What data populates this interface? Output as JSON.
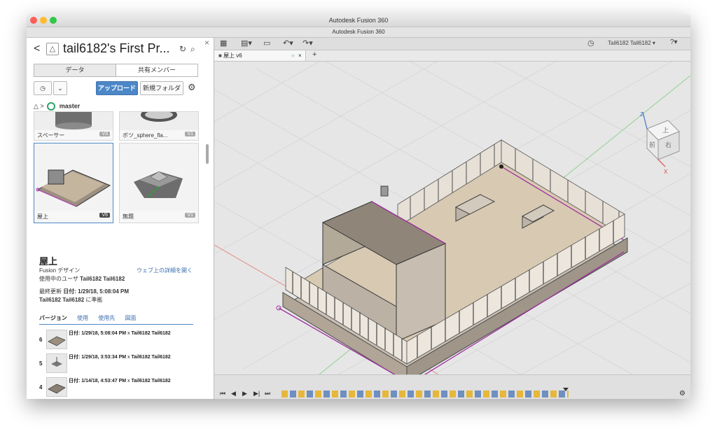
{
  "window": {
    "title": "Autodesk Fusion 360",
    "subtitle": "Autodesk Fusion 360",
    "traffic_colors": [
      "#fc5f57",
      "#fdbc2e",
      "#33c748"
    ]
  },
  "panel": {
    "back_label": "<",
    "project_title": "tail6182's First Pr...",
    "refresh_icon": "↻",
    "search_icon": "⌕",
    "close_label": "×",
    "tabs": [
      "データ",
      "共有メンバー"
    ],
    "upload_label": "アップロード",
    "new_folder_label": "新規フォルダ",
    "gear_icon": "⚙",
    "dropdown_icon": "⌄",
    "clock_icon": "◷",
    "branch_prefix": "△ >",
    "branch": "master",
    "files": [
      {
        "name": "スペーサー",
        "version": "V3"
      },
      {
        "name": "ボツ_sphere_fla...",
        "version": "V1"
      },
      {
        "name": "屋上",
        "version": "V6"
      },
      {
        "name": "無題",
        "version": "V1"
      }
    ]
  },
  "details": {
    "title": "屋上",
    "type": "Fusion デザイン",
    "web_link": "ウェブ上の詳細を開く",
    "user_label": "使用中のユーザ",
    "user_name": "Tail6182 Tail6182",
    "updated_label": "最終更新",
    "updated_value": "日付: 1/29/18, 5:08:04 PM",
    "updated_by": "Tail6182 Tail6182",
    "updated_suffix": "に準拠",
    "tabs": [
      "バージョン",
      "使用",
      "使用先",
      "図面"
    ],
    "versions": [
      {
        "num": "6",
        "date": "日付: 1/29/18, 5:08:04 PM",
        "sep": "x",
        "user": "Tail6182 Tail6182"
      },
      {
        "num": "5",
        "date": "日付: 1/29/18, 3:53:34 PM",
        "sep": "x",
        "user": "Tail6182 Tail6182"
      },
      {
        "num": "4",
        "date": "日付: 1/14/18, 4:53:47 PM",
        "sep": "x",
        "user": "Tail6182 Tail6182"
      }
    ]
  },
  "toolbar": {
    "user_label": "Tail6182 Tail6182 ▾",
    "help_icon": "?▾",
    "clock_icon": "◷"
  },
  "document_tab": {
    "label": "屋上 v6",
    "close": "×",
    "add": "+"
  },
  "viewcube": {
    "front": "前",
    "right": "右",
    "top": "上",
    "axis_x": "X",
    "axis_z": "Z"
  },
  "timeline": {
    "controls": [
      "⏮",
      "◀",
      "▶",
      "▶|",
      "⏭"
    ]
  }
}
